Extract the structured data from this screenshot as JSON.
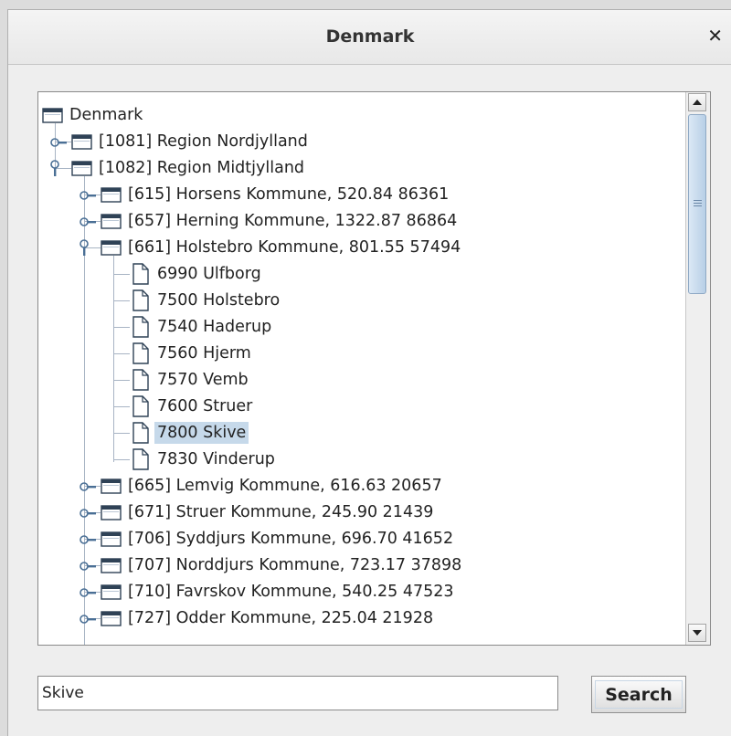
{
  "window": {
    "title": "Denmark"
  },
  "tree": {
    "rows": [
      {
        "text": "Denmark",
        "icon": "folder-icon",
        "depth": 0,
        "handle": "none",
        "selected": false
      },
      {
        "text": "[1081] Region Nordjylland",
        "icon": "folder-icon",
        "depth": 1,
        "handle": "collapsed",
        "selected": false
      },
      {
        "text": "[1082] Region Midtjylland",
        "icon": "folder-icon",
        "depth": 1,
        "handle": "expanded",
        "selected": false
      },
      {
        "text": "[615] Horsens Kommune, 520.84 86361",
        "icon": "folder-icon",
        "depth": 2,
        "handle": "collapsed",
        "selected": false
      },
      {
        "text": "[657] Herning Kommune, 1322.87 86864",
        "icon": "folder-icon",
        "depth": 2,
        "handle": "collapsed",
        "selected": false
      },
      {
        "text": "[661] Holstebro Kommune, 801.55 57494",
        "icon": "folder-icon",
        "depth": 2,
        "handle": "expanded",
        "selected": false
      },
      {
        "text": "6990 Ulfborg",
        "icon": "document-icon",
        "depth": 3,
        "handle": "leaf",
        "selected": false
      },
      {
        "text": "7500 Holstebro",
        "icon": "document-icon",
        "depth": 3,
        "handle": "leaf",
        "selected": false
      },
      {
        "text": "7540 Haderup",
        "icon": "document-icon",
        "depth": 3,
        "handle": "leaf",
        "selected": false
      },
      {
        "text": "7560 Hjerm",
        "icon": "document-icon",
        "depth": 3,
        "handle": "leaf",
        "selected": false
      },
      {
        "text": "7570 Vemb",
        "icon": "document-icon",
        "depth": 3,
        "handle": "leaf",
        "selected": false
      },
      {
        "text": "7600 Struer",
        "icon": "document-icon",
        "depth": 3,
        "handle": "leaf",
        "selected": false
      },
      {
        "text": "7800 Skive",
        "icon": "document-icon",
        "depth": 3,
        "handle": "leaf",
        "selected": true
      },
      {
        "text": "7830 Vinderup",
        "icon": "document-icon",
        "depth": 3,
        "handle": "leaf",
        "selected": false
      },
      {
        "text": "[665] Lemvig Kommune, 616.63 20657",
        "icon": "folder-icon",
        "depth": 2,
        "handle": "collapsed",
        "selected": false
      },
      {
        "text": "[671] Struer Kommune, 245.90 21439",
        "icon": "folder-icon",
        "depth": 2,
        "handle": "collapsed",
        "selected": false
      },
      {
        "text": "[706] Syddjurs Kommune, 696.70 41652",
        "icon": "folder-icon",
        "depth": 2,
        "handle": "collapsed",
        "selected": false
      },
      {
        "text": "[707] Norddjurs Kommune, 723.17 37898",
        "icon": "folder-icon",
        "depth": 2,
        "handle": "collapsed",
        "selected": false
      },
      {
        "text": "[710] Favrskov Kommune, 540.25 47523",
        "icon": "folder-icon",
        "depth": 2,
        "handle": "collapsed",
        "selected": false
      },
      {
        "text": "[727] Odder Kommune, 225.04 21928",
        "icon": "folder-icon",
        "depth": 2,
        "handle": "collapsed",
        "selected": false
      }
    ]
  },
  "scrollbar": {
    "up_icon": "arrow-up-icon",
    "down_icon": "arrow-down-icon"
  },
  "search": {
    "value": "Skive",
    "button_label": "Search"
  },
  "colors": {
    "selection": "#c6d9ea",
    "tree_line": "#a8b4c4",
    "folder_tab": "#2f4256",
    "thumb": "#b8cfe6"
  }
}
